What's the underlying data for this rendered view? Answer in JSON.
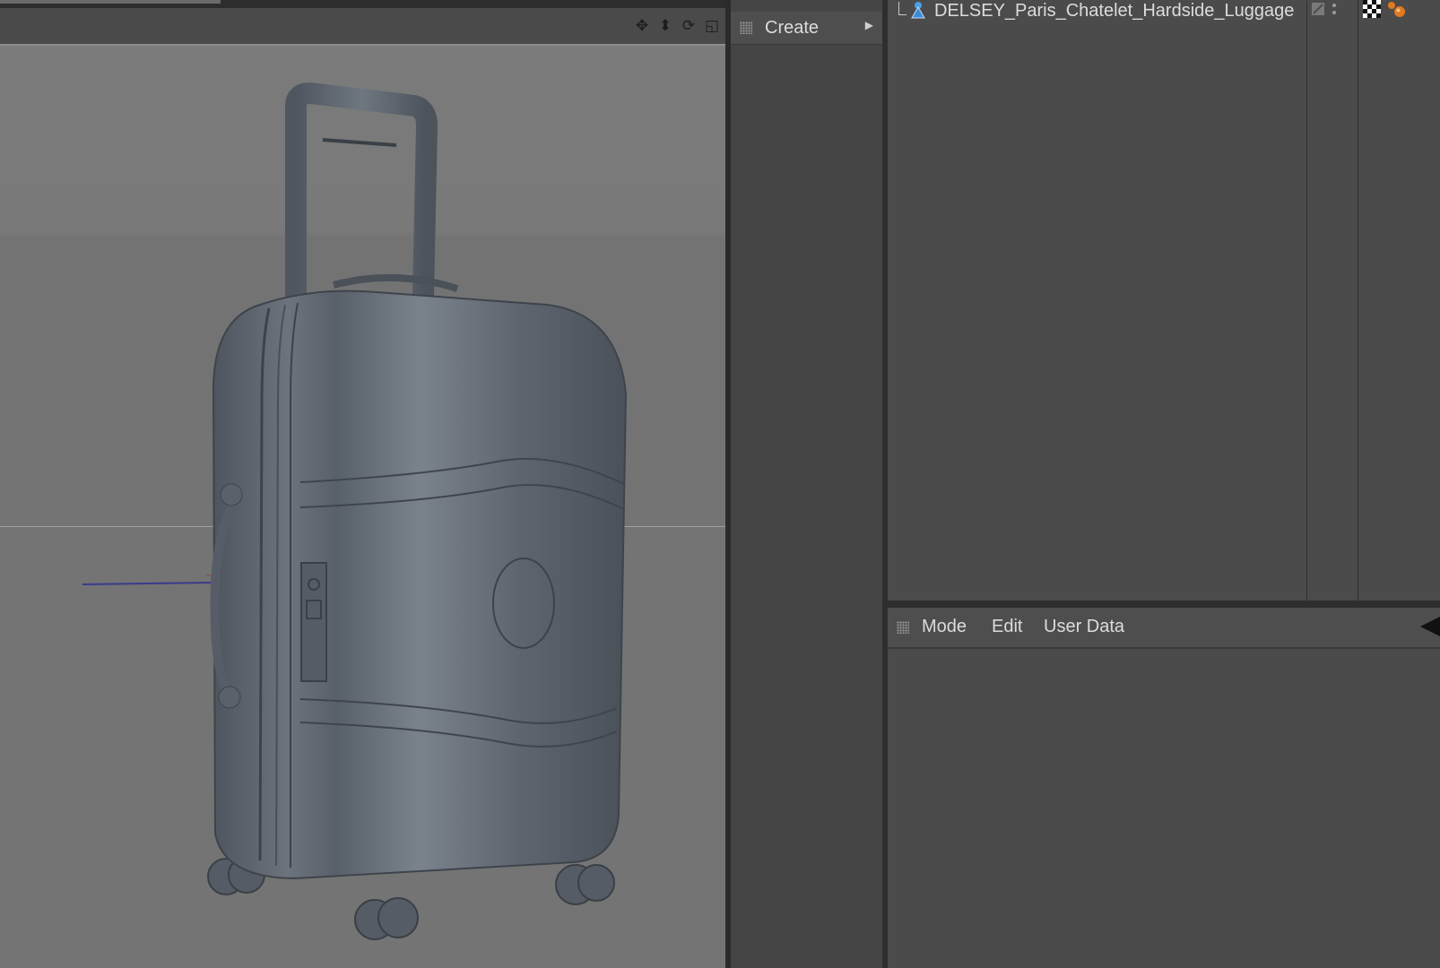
{
  "viewport": {
    "nav_icons": [
      "move-view-icon",
      "zoom-view-icon",
      "rotate-view-icon",
      "maximize-view-icon"
    ],
    "nav_glyphs": [
      "✥",
      "⬍",
      "⟳",
      "◱"
    ],
    "model_colors": {
      "body": "#59616b",
      "body_shadow": "#3f454d",
      "highlight": "#7c848d"
    }
  },
  "create_panel": {
    "label": "Create"
  },
  "object_manager": {
    "objects": [
      {
        "name": "DELSEY_Paris_Chatelet_Hardside_Luggage"
      }
    ]
  },
  "attributes_manager": {
    "menu": {
      "mode": "Mode",
      "edit": "Edit",
      "user_data": "User Data"
    }
  },
  "colors": {
    "panel_bg": "#4b4b4b",
    "viewport_bg": "#787878",
    "text": "#dcdcdc",
    "divider": "#2e2e2e",
    "tag_orange": "#e07a1f"
  }
}
